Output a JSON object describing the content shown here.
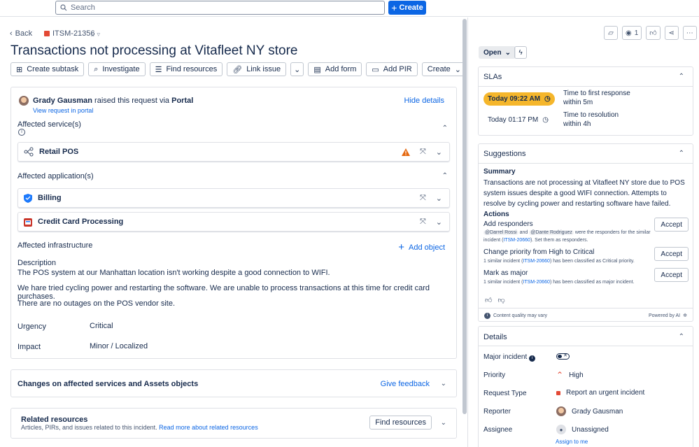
{
  "topbar": {
    "search_placeholder": "Search",
    "create_label": "Create"
  },
  "issue": {
    "back_label": "Back",
    "key": "ITSM-21356",
    "title": "Transactions not processing at Vitafleet NY store",
    "actions": [
      "Create subtask",
      "Investigate",
      "Find resources",
      "Link issue",
      "Add form",
      "Add PIR",
      "Create"
    ]
  },
  "request": {
    "reporter": "Grady Gausman",
    "raised_text": "raised this request via",
    "channel": "Portal",
    "view_link": "View request in portal",
    "hide_details": "Hide details",
    "affected_services_label": "Affected service(s)",
    "services": [
      {
        "name": "Retail POS"
      }
    ],
    "affected_apps_label": "Affected application(s)",
    "apps": [
      {
        "name": "Billing"
      },
      {
        "name": "Credit Card Processing"
      }
    ],
    "affected_infra_label": "Affected infrastructure",
    "add_object": "Add object",
    "description_label": "Description",
    "description": [
      "The POS system at our Manhattan location isn't working despite a good connection to WIFI.",
      "We hare tried cycling power and restarting the software. We are unable to process transactions at this time for credit card purchases.",
      "There are no outages on the POS vendor site."
    ],
    "urgency_label": "Urgency",
    "urgency": "Critical",
    "impact_label": "Impact",
    "impact": "Minor / Localized"
  },
  "changes": {
    "title": "Changes on affected services and Assets objects",
    "feedback": "Give feedback"
  },
  "related": {
    "title": "Related resources",
    "subtitle": "Articles, PIRs, and issues related to this incident.",
    "link": "Read more about related resources",
    "button": "Find resources"
  },
  "sidepanel": {
    "watchers": "1",
    "status": "Open",
    "slas": {
      "header": "SLAs",
      "items": [
        {
          "time": "Today 09:22 AM",
          "label": "Time to first response",
          "within": "within 5m",
          "highlight": true
        },
        {
          "time": "Today 01:17 PM",
          "label": "Time to resolution",
          "within": "within 4h",
          "highlight": false
        }
      ]
    },
    "suggestions": {
      "header": "Suggestions",
      "summary_label": "Summary",
      "summary": "Transactions are not processing at Vitafleet NY store due to POS system issues despite a good WIFI connection. Attempts to resolve by cycling power and restarting software have failed.",
      "actions_label": "Actions",
      "items": [
        {
          "title": "Add responders",
          "mention1": "@Darrel Rossi",
          "and": "and",
          "mention2": "@Dante Rodriguez",
          "text1": "were the responders for the similar incident (",
          "link": "ITSM-20660",
          "text2": "). Set them as responders.",
          "accept": "Accept"
        },
        {
          "title": "Change priority from High to Critical",
          "text1": "1 similar incident (",
          "link": "ITSM-20660",
          "text2": ") has been classified as Critical priority.",
          "accept": "Accept"
        },
        {
          "title": "Mark as major",
          "text1": "1 similar incident (",
          "link": "ITSM-20660",
          "text2": ") has been classified as major incident.",
          "accept": "Accept"
        }
      ],
      "quality_note": "Content quality may vary",
      "powered": "Powered by AI"
    },
    "details": {
      "header": "Details",
      "major_incident_label": "Major incident",
      "priority_label": "Priority",
      "priority": "High",
      "request_type_label": "Request Type",
      "request_type": "Report an urgent incident",
      "reporter_label": "Reporter",
      "reporter": "Grady Gausman",
      "assignee_label": "Assignee",
      "assignee": "Unassigned",
      "assign_to_me": "Assign to me"
    }
  }
}
